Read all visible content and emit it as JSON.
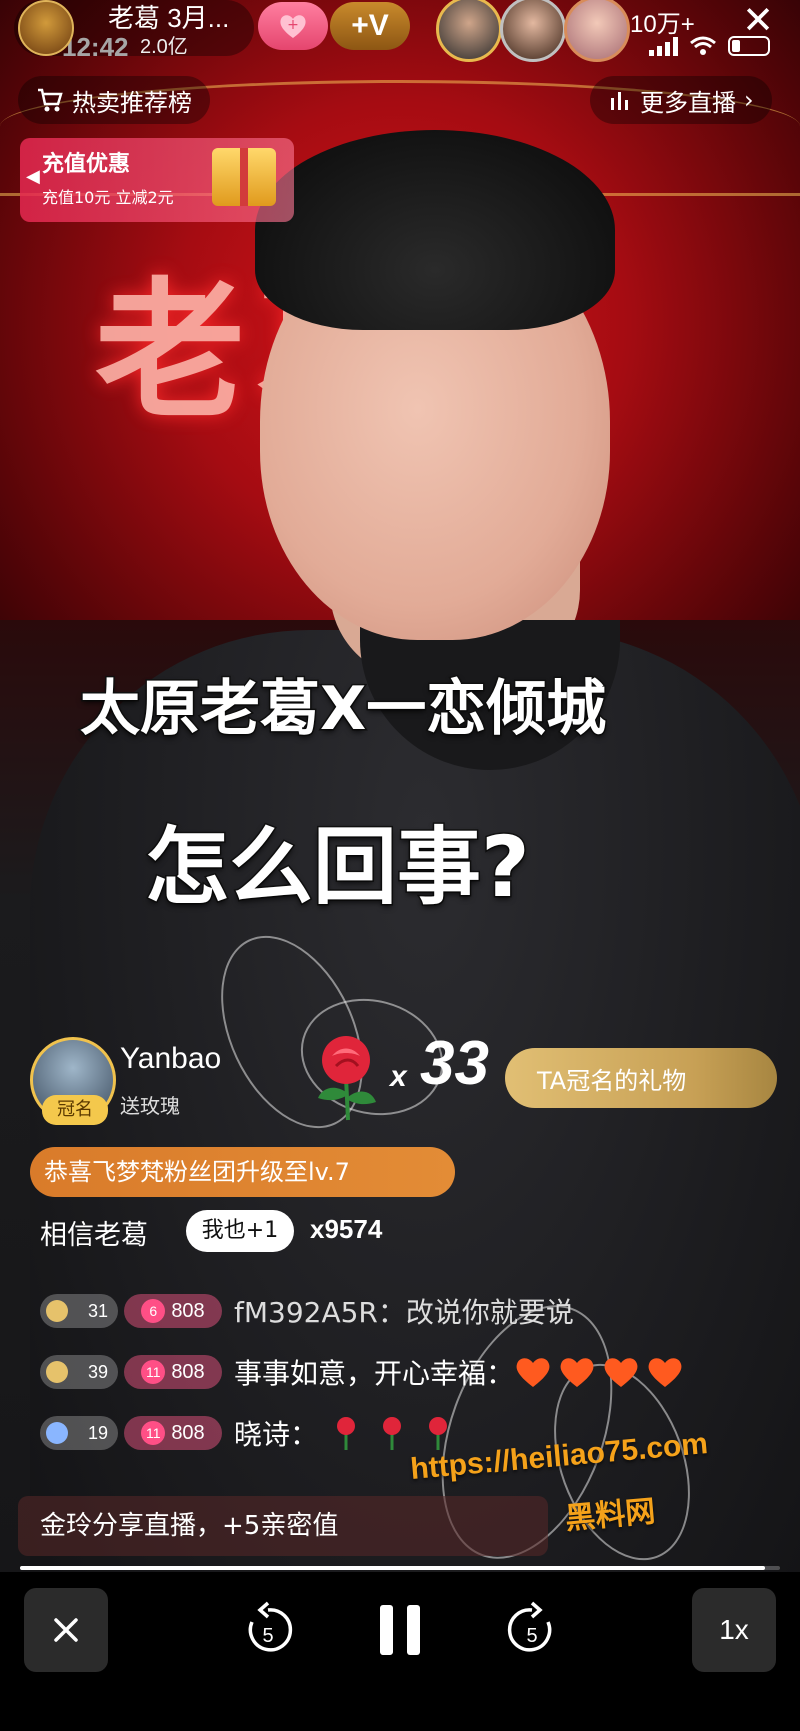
{
  "status_bar": {
    "time": "12:42"
  },
  "live_header": {
    "host_name": "老葛 3月...",
    "host_sub": "2.0亿",
    "plus_v_label": "+V",
    "viewer_count": "10万+"
  },
  "top_links": {
    "hot_list": "热卖推荐榜",
    "more_live": "更多直播"
  },
  "recharge": {
    "title": "充值优惠",
    "subtitle": "充值10元 立减2元"
  },
  "captions": {
    "line1": "太原老葛X一恋倾城",
    "line2": "怎么回事?"
  },
  "gift": {
    "user": "Yanbao",
    "badge": "冠名",
    "action": "送玫瑰",
    "x_label": "x",
    "count": "33",
    "ta_label": "TA冠名的礼物"
  },
  "fan_upgrade": "恭喜飞梦梵粉丝团升级至lv.7",
  "trust": {
    "text": "相信老葛",
    "button": "我也+1",
    "count": "x9574"
  },
  "comments": [
    {
      "level": "31",
      "fan_level_icon": "6",
      "fan_level": "808",
      "text": "fM392A5R：改说你就要说"
    },
    {
      "level": "39",
      "fan_level_icon": "11",
      "fan_level": "808",
      "text": "事事如意，开心幸福："
    },
    {
      "level": "19",
      "fan_level_icon": "11",
      "fan_level": "808",
      "text": "晓诗："
    }
  ],
  "share_text": "金玲分享直播，+5亲密值",
  "watermark": {
    "url": "https://heiliao75.com",
    "name": "黑料网"
  },
  "player": {
    "progress": 0.98,
    "rewind_seconds": "5",
    "forward_seconds": "5",
    "speed": "1x"
  },
  "colors": {
    "stage_red": "#c8101a",
    "gift_gold": "#d4b066",
    "fan_orange": "#dd8330",
    "watermark_orange": "#f5a21a"
  },
  "icons": [
    "cart-icon",
    "bar-chart-icon",
    "chevron-right-icon",
    "close-icon",
    "pause-icon",
    "rewind-5-icon",
    "forward-5-icon",
    "heart-icon",
    "rose-icon"
  ]
}
